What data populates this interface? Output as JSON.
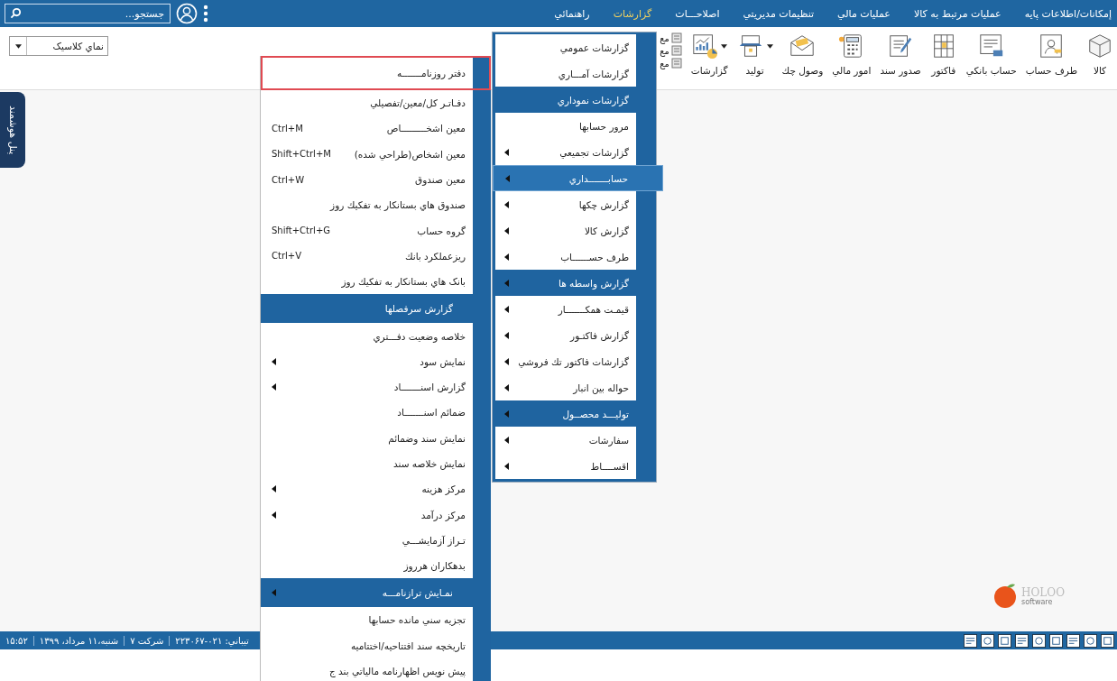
{
  "menu_bar": {
    "items": [
      {
        "label": "إمکانات/اطلاعات پايه",
        "selected": false
      },
      {
        "label": "عمليات مرتبط به کالا",
        "selected": false
      },
      {
        "label": "عمليات مالي",
        "selected": false
      },
      {
        "label": "تنظيمات مديريتي",
        "selected": false
      },
      {
        "label": "اصلاحـــات",
        "selected": false
      },
      {
        "label": "گزارشات",
        "selected": true
      },
      {
        "label": "راهنمائي",
        "selected": false
      }
    ],
    "search": {
      "placeholder": "جستجو..."
    }
  },
  "toolbar": {
    "tools": [
      {
        "label": "کالا",
        "caret": false
      },
      {
        "label": "طرف حساب",
        "caret": false
      },
      {
        "label": "حساب بانکي",
        "caret": false
      },
      {
        "label": "فاکتور",
        "caret": false
      },
      {
        "label": "صدور سند",
        "caret": false
      },
      {
        "label": "امور مالي",
        "caret": false
      },
      {
        "label": "وصول چك",
        "caret": false
      },
      {
        "label": "توليد",
        "caret": true
      },
      {
        "label": "گزارشات",
        "caret": true
      }
    ],
    "mini_tools": [
      "مع",
      "مع",
      "مع"
    ],
    "view_select": {
      "value": "نماي كلاسيک"
    }
  },
  "side_tab": {
    "label": "پنل هوشمند"
  },
  "reports_menu": {
    "items": [
      {
        "label": "گزارشات عمومي",
        "kind": "item",
        "arrow": false,
        "selected": false
      },
      {
        "label": "گزارشات آمـــاري",
        "kind": "item",
        "arrow": false,
        "selected": false
      },
      {
        "label": "گزارشات نموداري",
        "kind": "header",
        "arrow": false,
        "selected": false
      },
      {
        "label": "مرور حسابها",
        "kind": "item",
        "arrow": false,
        "selected": false
      },
      {
        "label": "گزارشات تجميعي",
        "kind": "item",
        "arrow": true,
        "selected": false
      },
      {
        "label": "حسابـــــــداري",
        "kind": "header",
        "arrow": true,
        "selected": true
      },
      {
        "label": "گزارش چكها",
        "kind": "item",
        "arrow": true,
        "selected": false
      },
      {
        "label": "گزارش کالا",
        "kind": "item",
        "arrow": true,
        "selected": false
      },
      {
        "label": "طرف حســــــاب",
        "kind": "item",
        "arrow": true,
        "selected": false
      },
      {
        "label": "گزارش واسطه ها",
        "kind": "header",
        "arrow": true,
        "selected": false
      },
      {
        "label": "قيمـت همكـــــــار",
        "kind": "item",
        "arrow": true,
        "selected": false
      },
      {
        "label": "گزارش فاكتـور",
        "kind": "item",
        "arrow": true,
        "selected": false
      },
      {
        "label": "گزارشات فاكتور تك فروشي",
        "kind": "item",
        "arrow": true,
        "selected": false
      },
      {
        "label": "حواله بين انبار",
        "kind": "item",
        "arrow": true,
        "selected": false
      },
      {
        "label": "توليـــد محصــول",
        "kind": "header",
        "arrow": true,
        "selected": false
      },
      {
        "label": "سفارشات",
        "kind": "item",
        "arrow": true,
        "selected": false
      },
      {
        "label": "اقســــاط",
        "kind": "item",
        "arrow": true,
        "selected": false
      }
    ]
  },
  "accounting_menu": {
    "items": [
      {
        "label": "دفتر روزنامـــــــه",
        "kind": "item",
        "arrow": false,
        "selected": true
      },
      {
        "label": "دفـاتـر كل/معين/تفصيلي",
        "kind": "item",
        "arrow": false,
        "selected": false
      },
      {
        "label": "معين اشخـــــــــاص",
        "shortcut": "Ctrl+M",
        "kind": "item",
        "arrow": false,
        "selected": false
      },
      {
        "label": "معين اشخاص(طراحي شده)",
        "shortcut": "Shift+Ctrl+M",
        "kind": "item",
        "arrow": false,
        "selected": false
      },
      {
        "label": "معين صندوق",
        "shortcut": "Ctrl+W",
        "kind": "item",
        "arrow": false,
        "selected": false
      },
      {
        "label": "صندوق هاي بستانكار به تفكيك روز",
        "kind": "item",
        "arrow": false,
        "selected": false
      },
      {
        "label": "گروه حساب",
        "shortcut": "Shift+Ctrl+G",
        "kind": "item",
        "arrow": false,
        "selected": false
      },
      {
        "label": "ريزعملكرد بانك",
        "shortcut": "Ctrl+V",
        "kind": "item",
        "arrow": false,
        "selected": false
      },
      {
        "label": "بانک هاي بستانكار به تفكيك روز",
        "kind": "item",
        "arrow": false,
        "selected": false
      },
      {
        "label": "گزارش سرفصلها",
        "kind": "header",
        "arrow": false,
        "selected": false
      },
      {
        "label": "خلاصه وضعيت دفـــتري",
        "kind": "item",
        "arrow": false,
        "selected": false
      },
      {
        "label": "نمايش سود",
        "kind": "item",
        "arrow": true,
        "selected": false
      },
      {
        "label": "گزارش  اسنـــــــاد",
        "kind": "item",
        "arrow": true,
        "selected": false
      },
      {
        "label": "ضمائم اسنـــــــاد",
        "kind": "item",
        "arrow": false,
        "selected": false
      },
      {
        "label": "نمايش سند وضمائم",
        "kind": "item",
        "arrow": false,
        "selected": false
      },
      {
        "label": "نمايش خلاصه سند",
        "kind": "item",
        "arrow": false,
        "selected": false
      },
      {
        "label": "مركز هزينه",
        "kind": "item",
        "arrow": true,
        "selected": false
      },
      {
        "label": "مركز درآمد",
        "kind": "item",
        "arrow": true,
        "selected": false
      },
      {
        "label": "تـراز آزمايشـــي",
        "kind": "item",
        "arrow": false,
        "selected": false
      },
      {
        "label": "بدهكاران هرروز",
        "kind": "item",
        "arrow": false,
        "selected": false
      },
      {
        "label": "نمـايش ترازنامـــه",
        "kind": "header",
        "arrow": true,
        "selected": false
      },
      {
        "label": "تجزيه سني مانده حسابها",
        "kind": "item",
        "arrow": false,
        "selected": false
      },
      {
        "label": "تاريخچه سند افتتاحيه/اختتاميه",
        "kind": "item",
        "arrow": false,
        "selected": false
      },
      {
        "label": "پيش نويس اظهارنامه مالياتي بند ج",
        "kind": "item",
        "arrow": false,
        "selected": false
      }
    ]
  },
  "logo": {
    "name": "HOLOO",
    "tagline": "software"
  },
  "status_bar": {
    "time": "۱۵:۵۲",
    "date": "شنبه،۱۱ مرداد، ۱۳۹۹",
    "company": "شرکت ۷",
    "support": "تيباني: ۰۲۱-۲۲۳۰۶۷"
  }
}
